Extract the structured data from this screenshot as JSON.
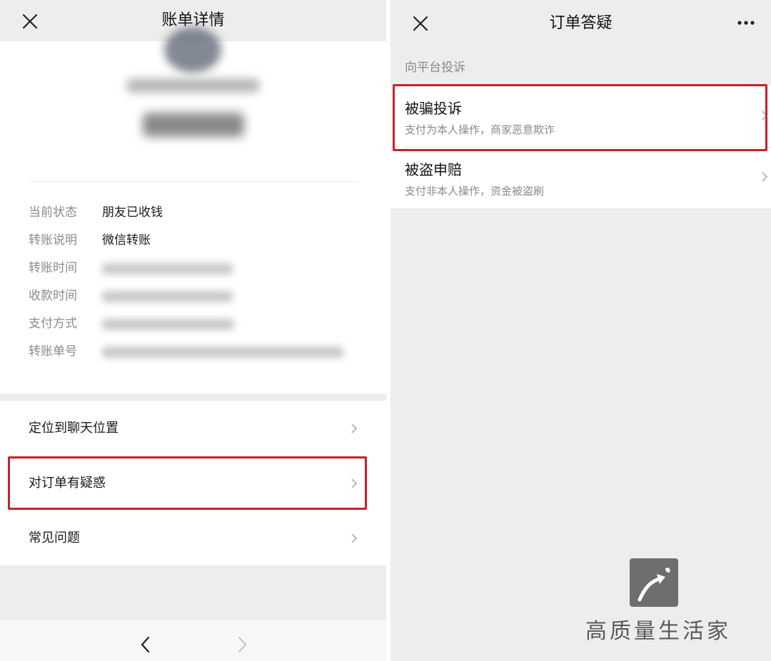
{
  "left": {
    "nav_title": "账单详情",
    "info": [
      {
        "label": "当前状态",
        "value": "朋友已收钱"
      },
      {
        "label": "转账说明",
        "value": "微信转账"
      },
      {
        "label": "转账时间",
        "value": ""
      },
      {
        "label": "收款时间",
        "value": ""
      },
      {
        "label": "支付方式",
        "value": ""
      },
      {
        "label": "转账单号",
        "value": ""
      }
    ],
    "menu": [
      {
        "label": "定位到聊天位置"
      },
      {
        "label": "对订单有疑惑"
      },
      {
        "label": "常见问题"
      }
    ]
  },
  "right": {
    "nav_title": "订单答疑",
    "section_title": "向平台投诉",
    "items": [
      {
        "title": "被骗投诉",
        "desc": "支付为本人操作，商家恶意欺诈"
      },
      {
        "title": "被盗申赔",
        "desc": "支付非本人操作，资金被盗刷"
      }
    ]
  },
  "watermark": {
    "text": "高质量生活家"
  },
  "colors": {
    "highlight": "#c8202a",
    "background": "#ededed",
    "secondary_text": "#8a8a8a"
  },
  "icons": [
    "close-icon",
    "more-icon",
    "chevron-right-icon",
    "back-arrow-icon",
    "forward-arrow-icon"
  ]
}
